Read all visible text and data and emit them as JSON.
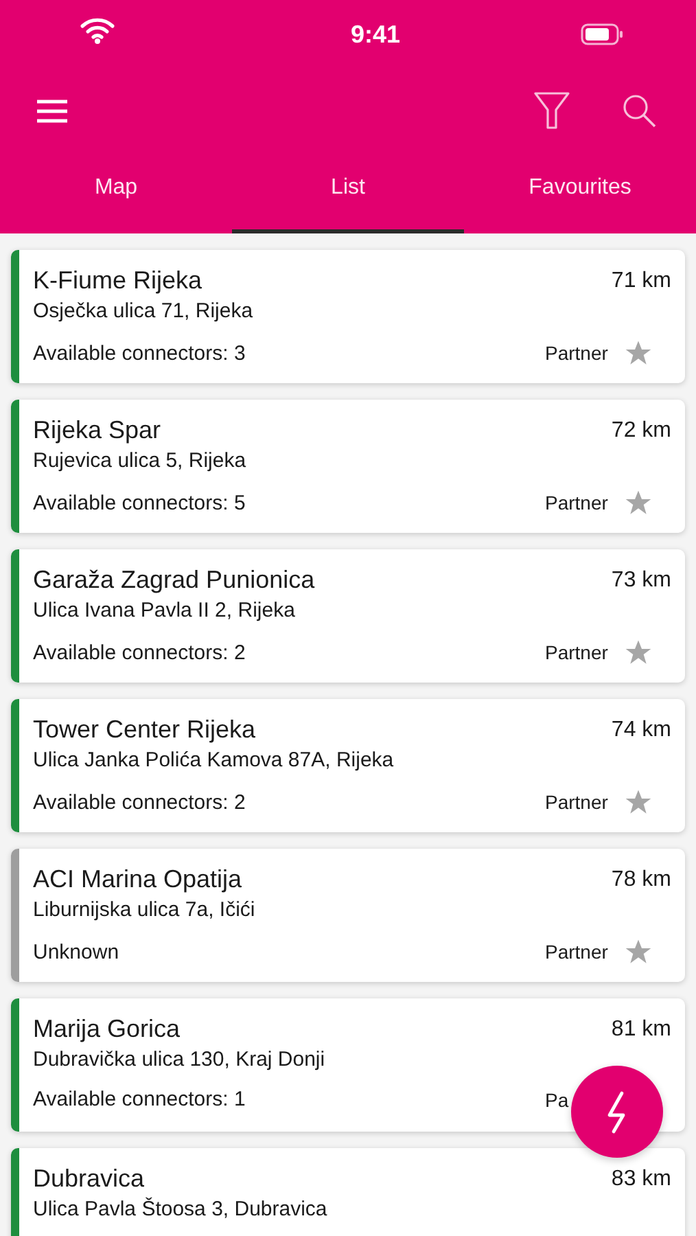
{
  "status_bar": {
    "time": "9:41"
  },
  "tabs": [
    {
      "label": "Map",
      "selected": false
    },
    {
      "label": "List",
      "selected": true
    },
    {
      "label": "Favourites",
      "selected": false
    }
  ],
  "stations": [
    {
      "name": "K-Fiume Rijeka",
      "distance": "71 km",
      "address": "Osječka ulica 71, Rijeka",
      "availability": "Available connectors: 3",
      "type": "Partner",
      "star": true,
      "color": "#1e8e3e"
    },
    {
      "name": "Rijeka Spar",
      "distance": "72 km",
      "address": "Rujevica ulica 5, Rijeka",
      "availability": "Available connectors: 5",
      "type": "Partner",
      "star": true,
      "color": "#1e8e3e"
    },
    {
      "name": "Garaža Zagrad Punionica",
      "distance": "73 km",
      "address": "Ulica Ivana Pavla II 2, Rijeka",
      "availability": "Available connectors: 2",
      "type": "Partner",
      "star": true,
      "color": "#1e8e3e"
    },
    {
      "name": "Tower Center Rijeka",
      "distance": "74 km",
      "address": "Ulica Janka Polića Kamova 87A, Rijeka",
      "availability": "Available connectors: 2",
      "type": "Partner",
      "star": true,
      "color": "#1e8e3e"
    },
    {
      "name": "ACI Marina Opatija",
      "distance": "78 km",
      "address": "Liburnijska ulica 7a, Ičići",
      "availability": "Unknown",
      "type": "Partner",
      "star": true,
      "color": "#9e9e9e"
    },
    {
      "name": "Marija Gorica",
      "distance": "81 km",
      "address": "Dubravička ulica 130, Kraj Donji",
      "availability": "Available connectors: 1",
      "type": "Pa",
      "star": false,
      "color": "#1e8e3e"
    },
    {
      "name": "Dubravica",
      "distance": "83 km",
      "address": "Ulica Pavla Štoosa 3, Dubravica",
      "color": "#1e8e3e"
    }
  ]
}
